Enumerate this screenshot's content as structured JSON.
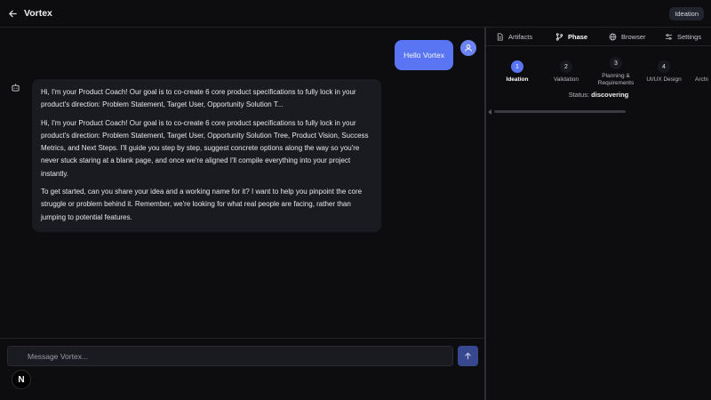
{
  "header": {
    "app_title": "Vortex",
    "phase_badge": "Ideation"
  },
  "chat": {
    "user_message": "Hello Vortex",
    "bot_message": {
      "preview": "Hi, I'm your Product Coach! Our goal is to co-create 6 core product specifications to fully lock in your product's direction: Problem Statement, Target User, Opportunity Solution T...",
      "paragraph_1": "Hi, I'm your Product Coach! Our goal is to co-create 6 core product specifications to fully lock in your product's direction: Problem Statement, Target User, Opportunity Solution Tree, Product Vision, Success Metrics, and Next Steps. I'll guide you step by step, suggest concrete options along the way so you're never stuck staring at a blank page, and once we're aligned I'll compile everything into your project instantly.",
      "paragraph_2": "To get started, can you share your idea and a working name for it? I want to help you pinpoint the core struggle or problem behind it. Remember, we're looking for what real people are facing, rather than jumping to potential features."
    },
    "composer": {
      "placeholder": "Message Vortex...",
      "value": ""
    },
    "overlay_badge": "N"
  },
  "panel": {
    "tabs": [
      {
        "label": "Artifacts",
        "icon": "file-icon",
        "active": false
      },
      {
        "label": "Phase",
        "icon": "git-branch-icon",
        "active": true
      },
      {
        "label": "Browser",
        "icon": "globe-icon",
        "active": false
      },
      {
        "label": "Settings",
        "icon": "sliders-icon",
        "active": false
      }
    ],
    "steps": [
      {
        "number": "1",
        "label": "Ideation",
        "active": true
      },
      {
        "number": "2",
        "label": "Validation",
        "active": false
      },
      {
        "number": "3",
        "label": "Planning & Requirements",
        "active": false
      },
      {
        "number": "4",
        "label": "UI/UX Design",
        "active": false
      },
      {
        "number": "",
        "label": "Archi",
        "active": false
      }
    ],
    "status_label": "Status:",
    "status_value": "discovering"
  },
  "colors": {
    "accent": "#5a75f3",
    "background": "#0d0d0f",
    "bubble": "#1a1b21"
  }
}
